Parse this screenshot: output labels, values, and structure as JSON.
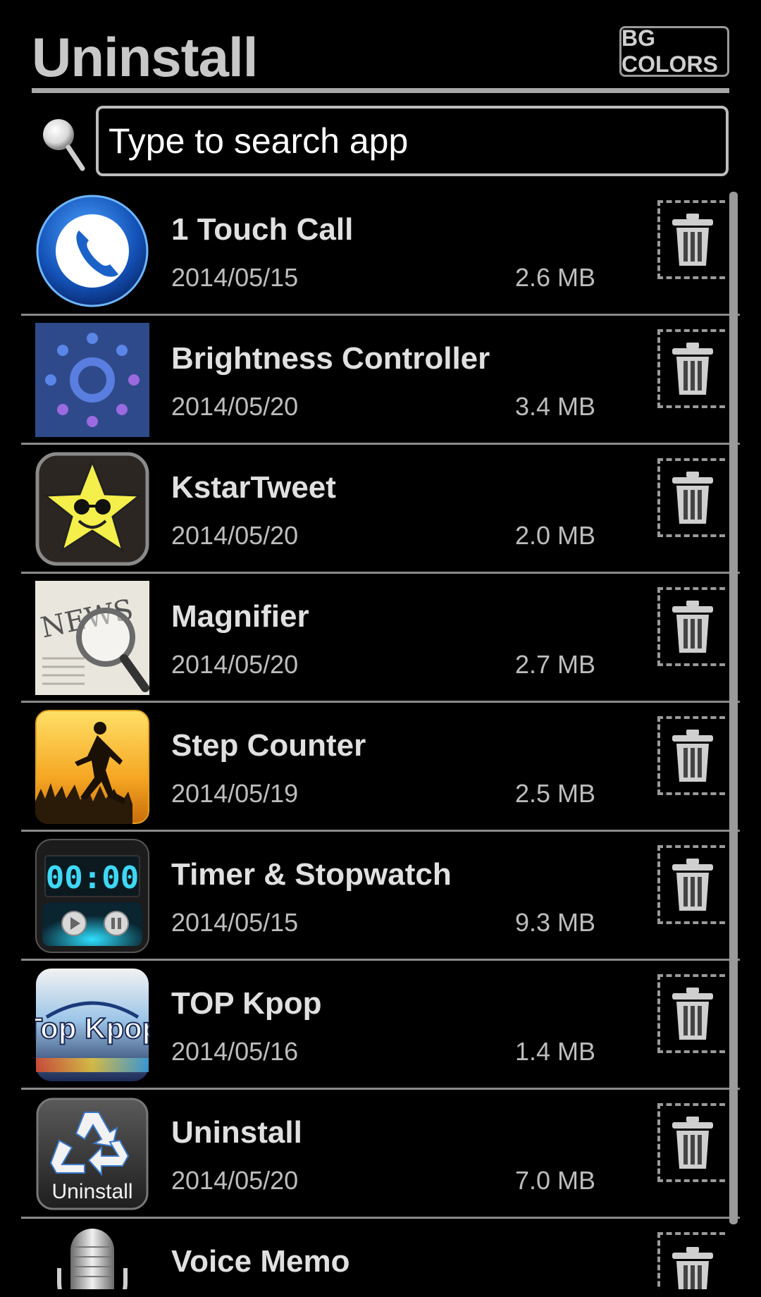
{
  "header": {
    "title": "Uninstall",
    "bg_colors_label": "BG COLORS"
  },
  "search": {
    "placeholder": "Type to search app",
    "icon": "magnifier-icon"
  },
  "apps": [
    {
      "name": "1 Touch Call",
      "date": "2014/05/15",
      "size": "2.6 MB",
      "icon": "phone-icon"
    },
    {
      "name": "Brightness Controller",
      "date": "2014/05/20",
      "size": "3.4 MB",
      "icon": "brightness-icon"
    },
    {
      "name": "KstarTweet",
      "date": "2014/05/20",
      "size": "2.0 MB",
      "icon": "star-sunglasses-icon"
    },
    {
      "name": "Magnifier",
      "date": "2014/05/20",
      "size": "2.7 MB",
      "icon": "news-magnifier-icon"
    },
    {
      "name": "Step Counter",
      "date": "2014/05/19",
      "size": "2.5 MB",
      "icon": "runner-icon"
    },
    {
      "name": "Timer & Stopwatch",
      "date": "2014/05/15",
      "size": "9.3 MB",
      "icon": "timer-icon",
      "display": "00:00"
    },
    {
      "name": "TOP Kpop",
      "date": "2014/05/16",
      "size": "1.4 MB",
      "icon": "top-kpop-icon",
      "logo_text": "Top Kpop"
    },
    {
      "name": "Uninstall",
      "date": "2014/05/20",
      "size": "7.0 MB",
      "icon": "recycle-icon",
      "logo_text": "Uninstall"
    },
    {
      "name": "Voice Memo",
      "date": "",
      "size": "",
      "icon": "microphone-icon"
    }
  ],
  "colors": {
    "background": "#000000",
    "title": "#c8c8c8",
    "divider": "#8a8a8a",
    "name_text": "#e0e0e0",
    "meta_text": "#bdbdbd"
  }
}
